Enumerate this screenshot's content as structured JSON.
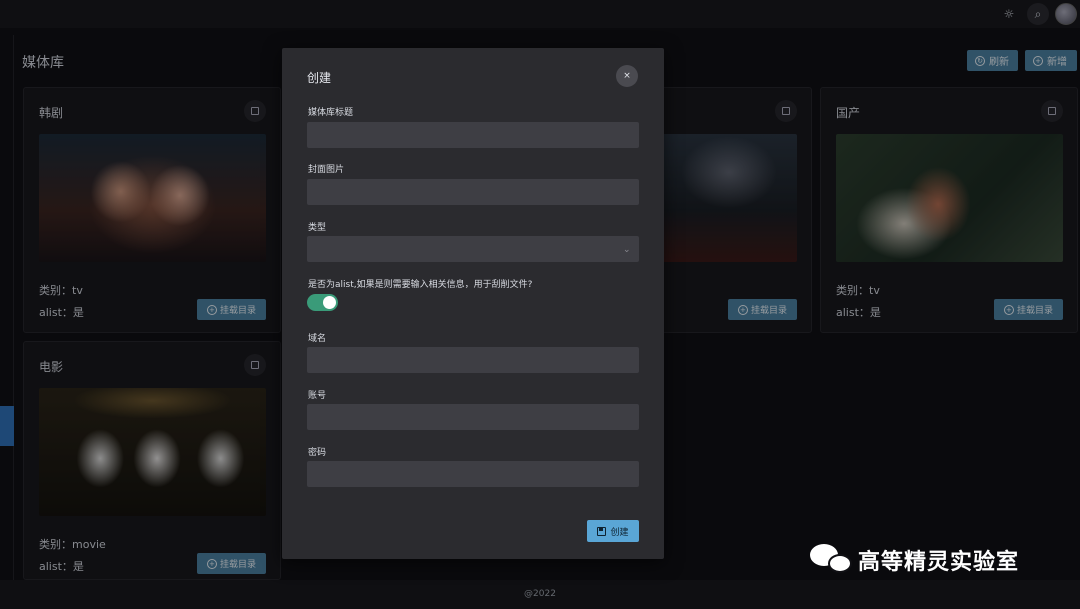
{
  "header": {
    "theme_icon": "sun-icon",
    "search_icon": "search-icon",
    "avatar": "user-avatar"
  },
  "page": {
    "title": "媒体库",
    "refresh_label": "刷新",
    "add_label": "新增"
  },
  "cards": [
    {
      "title": "韩剧",
      "category": "类别：tv",
      "alist": "alist：是",
      "mount_label": "挂载目录"
    },
    {
      "title": "",
      "category": "",
      "alist": "",
      "mount_label": "挂载目录"
    },
    {
      "title": "国产",
      "category": "类别：tv",
      "alist": "alist：是",
      "mount_label": "挂载目录"
    },
    {
      "title": "电影",
      "category": "类别：movie",
      "alist": "alist：是",
      "mount_label": "挂载目录"
    }
  ],
  "modal": {
    "title": "创建",
    "close_label": "×",
    "fields": {
      "library_title": {
        "label": "媒体库标题",
        "value": ""
      },
      "cover_image": {
        "label": "封面图片",
        "value": ""
      },
      "type": {
        "label": "类型",
        "value": ""
      },
      "alist_toggle": {
        "label": "是否为alist,如果是则需要输入相关信息，用于刮削文件?",
        "enabled": true
      },
      "domain": {
        "label": "域名",
        "value": ""
      },
      "account": {
        "label": "账号",
        "value": ""
      },
      "password": {
        "label": "密码",
        "value": ""
      }
    },
    "create_label": "创建"
  },
  "footer": {
    "text": "@2022"
  },
  "watermark": {
    "text": "高等精灵实验室"
  },
  "colors": {
    "accent_button": "#4b7e9e",
    "create_button": "#5aa6d6",
    "toggle_on": "#3a9b79",
    "sidebar_active": "#2f6fb6"
  }
}
